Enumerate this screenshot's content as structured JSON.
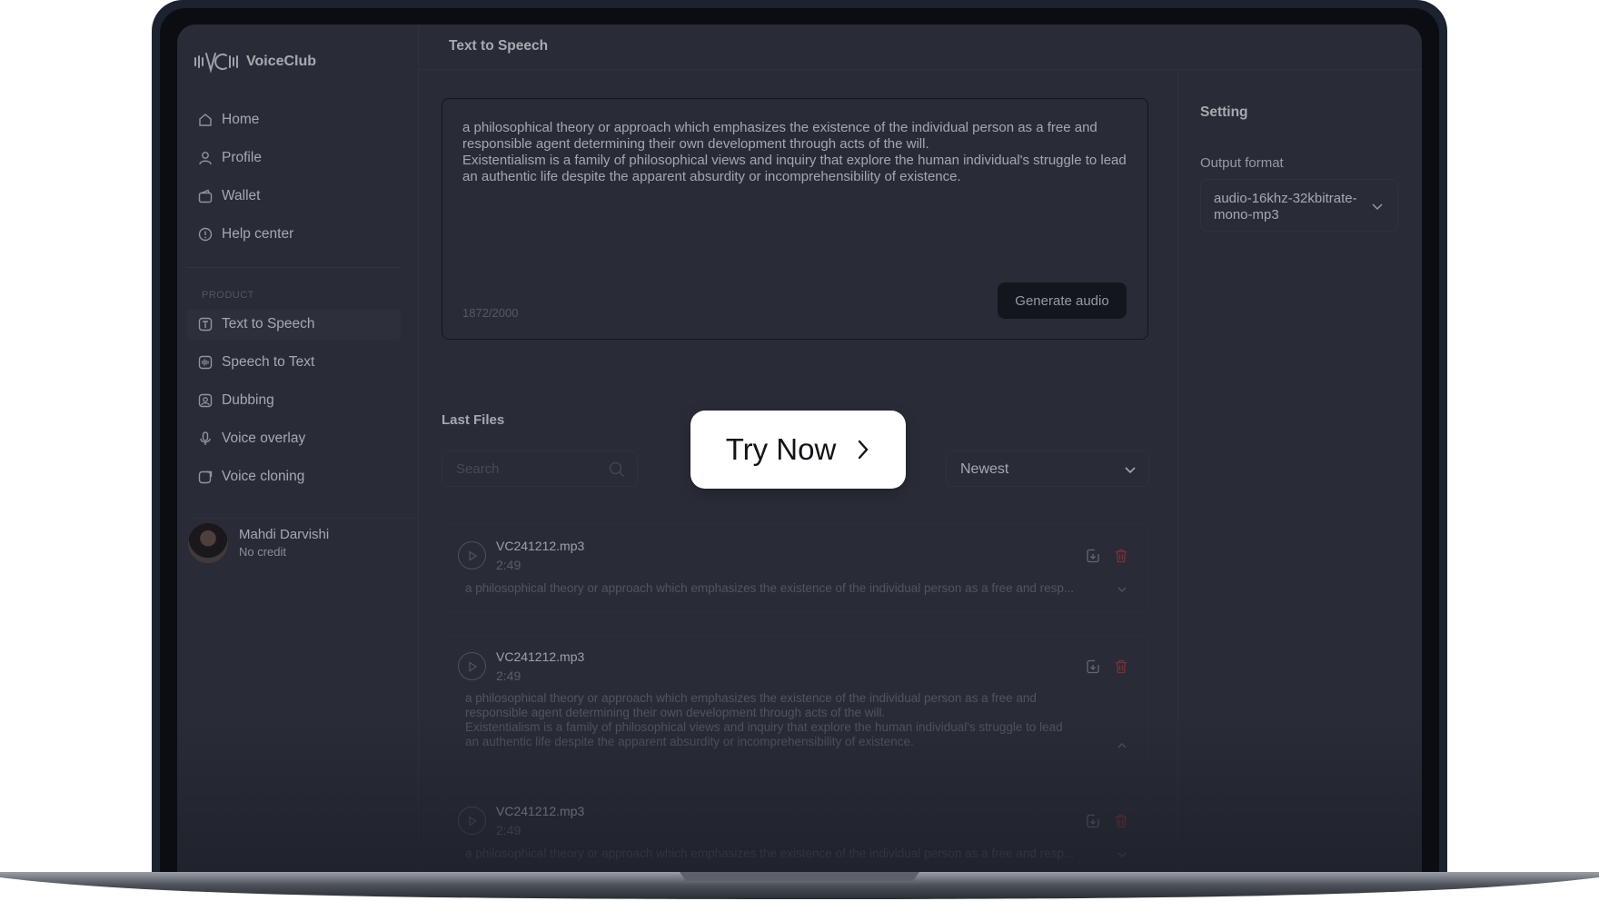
{
  "app": {
    "name": "VoiceClub"
  },
  "sidebar": {
    "nav": [
      {
        "label": "Home",
        "icon": "home-icon"
      },
      {
        "label": "Profile",
        "icon": "user-icon"
      },
      {
        "label": "Wallet",
        "icon": "wallet-icon"
      },
      {
        "label": "Help center",
        "icon": "help-icon"
      }
    ],
    "section_label": "PRODUCT",
    "products": [
      {
        "label": "Text to Speech",
        "icon": "text-icon",
        "active": true
      },
      {
        "label": "Speech to Text",
        "icon": "waveform-icon"
      },
      {
        "label": "Dubbing",
        "icon": "dubbing-icon"
      },
      {
        "label": "Voice overlay",
        "icon": "microphone-icon"
      },
      {
        "label": "Voice cloning",
        "icon": "clone-icon"
      }
    ],
    "profile": {
      "name": "Mahdi Darvishi",
      "credit": "No credit"
    }
  },
  "header": {
    "title": "Text to Speech"
  },
  "editor": {
    "text": "a philosophical theory or approach which emphasizes the existence of the individual person as a free and responsible agent determining their own development through acts of the will.\nExistentialism is a family of philosophical views and inquiry that explore the human individual's struggle to lead an authentic life despite the apparent absurdity or incomprehensibility of existence.",
    "char_count": "1872/2000",
    "generate_label": "Generate audio"
  },
  "files": {
    "title": "Last Files",
    "search_placeholder": "Search",
    "sort_value": "Newest",
    "items": [
      {
        "name": "VC241212.mp3",
        "duration": "2:49",
        "desc": "a philosophical theory or approach which emphasizes the existence of the individual person as a free and resp...",
        "expanded": false
      },
      {
        "name": "VC241212.mp3",
        "duration": "2:49",
        "desc": "a philosophical theory or approach which emphasizes the existence of the individual person as a free and\nresponsible agent determining their own development through acts of the will.\nExistentialism is a family of philosophical views and inquiry that explore the human individual's struggle to lead\nan authentic life despite the apparent absurdity or incomprehensibility of existence.",
        "expanded": true
      },
      {
        "name": "VC241212.mp3",
        "duration": "2:49",
        "desc": "a philosophical theory or approach which emphasizes the existence of the individual person as a free and resp...",
        "expanded": false
      }
    ]
  },
  "settings": {
    "title": "Setting",
    "output_label": "Output format",
    "output_value": "audio-16khz-32kbitrate-mono-mp3"
  },
  "cta": {
    "label": "Try Now"
  },
  "colors": {
    "background": "#30333e",
    "delete": "#b4373f",
    "button": "#0f1218"
  }
}
